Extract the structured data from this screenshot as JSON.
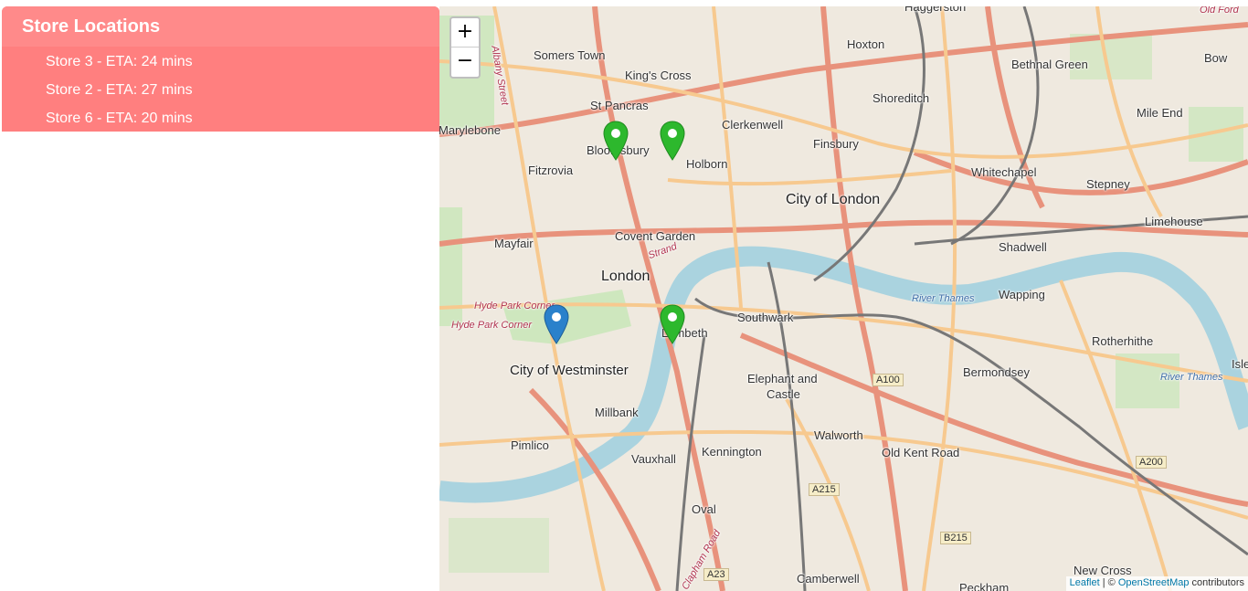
{
  "sidebar": {
    "title": "Store Locations",
    "stores": [
      {
        "label": "Store 3 - ETA: 24 mins"
      },
      {
        "label": "Store 2 - ETA: 27 mins"
      },
      {
        "label": "Store 6 - ETA: 20 mins"
      }
    ]
  },
  "map": {
    "zoom_in": "+",
    "zoom_out": "−",
    "attribution": {
      "leaflet": "Leaflet",
      "separator": " | © ",
      "osm": "OpenStreetMap",
      "suffix": " contributors"
    },
    "places": {
      "haggerston": "Haggerston",
      "old_ford": "Old Ford",
      "hoxton": "Hoxton",
      "somers_town": "Somers Town",
      "kings_cross": "King's Cross",
      "bethnal_green": "Bethnal Green",
      "bow": "Bow",
      "st_pancras": "St Pancras",
      "shoreditch": "Shoreditch",
      "mile_end": "Mile End",
      "marylebone": "Marylebone",
      "clerkenwell": "Clerkenwell",
      "bloomsbury": "Bloomsbury",
      "finsbury": "Finsbury",
      "fitzrovia": "Fitzrovia",
      "holborn": "Holborn",
      "whitechapel": "Whitechapel",
      "stepney": "Stepney",
      "city_of_london": "City of London",
      "limehouse": "Limehouse",
      "covent_garden": "Covent Garden",
      "mayfair": "Mayfair",
      "shadwell": "Shadwell",
      "london": "London",
      "wapping": "Wapping",
      "hyde_park_corner_1": "Hyde Park Corner",
      "hyde_park_corner_2": "Hyde Park Corner",
      "southwark": "Southwark",
      "lambeth": "Lambeth",
      "rotherhithe": "Rotherhithe",
      "city_of_westminster": "City of Westminster",
      "elephant_and": "Elephant and",
      "castle": "Castle",
      "bermondsey": "Bermondsey",
      "isle": "Isle",
      "millbank": "Millbank",
      "walworth": "Walworth",
      "pimlico": "Pimlico",
      "old_kent_road": "Old Kent Road",
      "vauxhall": "Vauxhall",
      "kennington": "Kennington",
      "oval": "Oval",
      "new_cross": "New Cross",
      "camberwell": "Camberwell",
      "peckham": "Peckham",
      "river_thames_1": "River Thames",
      "river_thames_2": "River Thames",
      "strand": "Strand",
      "albany_street": "Albany Street",
      "clapham_road": "Clapham Road"
    },
    "shields": {
      "a100": "A100",
      "a200": "A200",
      "a215": "A215",
      "b215": "B215",
      "a23": "A23"
    },
    "markers": [
      {
        "name": "store-marker",
        "color": "#2db82d"
      },
      {
        "name": "store-marker",
        "color": "#2db82d"
      },
      {
        "name": "store-marker",
        "color": "#2db82d"
      },
      {
        "name": "user-location-marker",
        "color": "#2a81cb"
      }
    ],
    "colors": {
      "river": "#aad3df",
      "park": "#c8e6b8",
      "major_road": "#e8927c",
      "secondary_road": "#f7c98f",
      "railway": "#777777",
      "land": "#efe9df"
    }
  }
}
